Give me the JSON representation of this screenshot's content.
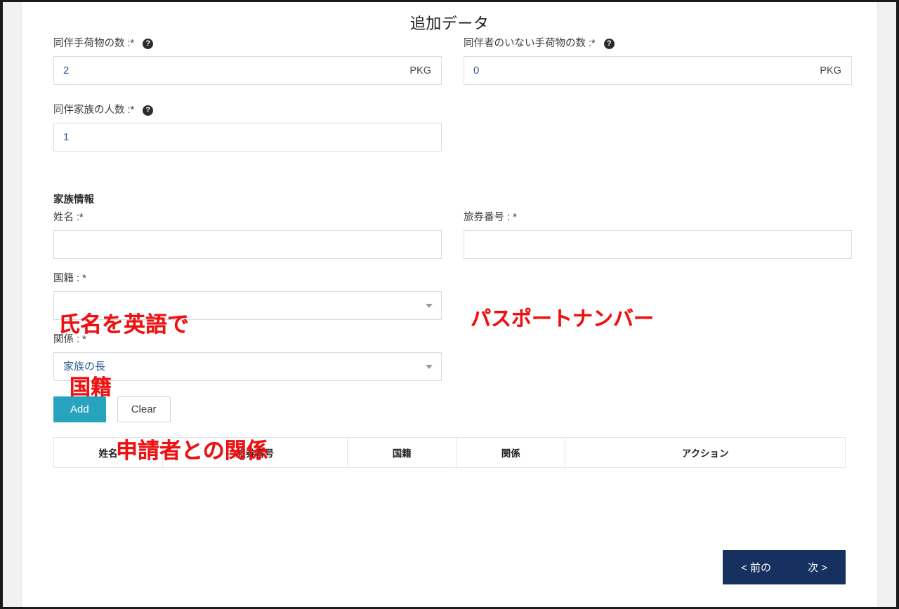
{
  "page": {
    "title": "追加データ"
  },
  "fields": {
    "accompanied_baggage": {
      "label": "同伴手荷物の数 :*",
      "help_icon": "help-circle-icon",
      "value": "2",
      "unit": "PKG"
    },
    "unaccompanied_baggage": {
      "label": "同伴者のいない手荷物の数 :*",
      "help_icon": "help-circle-icon",
      "value": "0",
      "unit": "PKG"
    },
    "family_members_count": {
      "label": "同伴家族の人数 :*",
      "help_icon": "help-circle-icon",
      "value": "1"
    }
  },
  "family_section": {
    "heading": "家族情報",
    "name": {
      "label": "姓名 :*",
      "value": ""
    },
    "passport": {
      "label": "旅券番号 : *",
      "value": ""
    },
    "nationality": {
      "label": "国籍 : *",
      "value": "",
      "caret_icon": "chevron-down-icon"
    },
    "relation": {
      "label": "関係 : *",
      "value": "家族の長",
      "caret_icon": "chevron-down-icon"
    },
    "buttons": {
      "add": "Add",
      "clear": "Clear"
    },
    "table": {
      "columns": [
        "姓名",
        "旅券番号",
        "国籍",
        "関係",
        "アクション"
      ],
      "rows": []
    }
  },
  "annotations": {
    "name_hint": "氏名を英語で",
    "passport_hint": "パスポートナンバー",
    "nationality_hint": "国籍",
    "relation_hint": "申請者との関係"
  },
  "navigation": {
    "previous": "< 前の",
    "next": "次 >"
  },
  "colors": {
    "annotation_red": "#ee1111",
    "add_button": "#28a3bd",
    "nav_background": "#16305f",
    "input_text": "#2f5d8e"
  }
}
